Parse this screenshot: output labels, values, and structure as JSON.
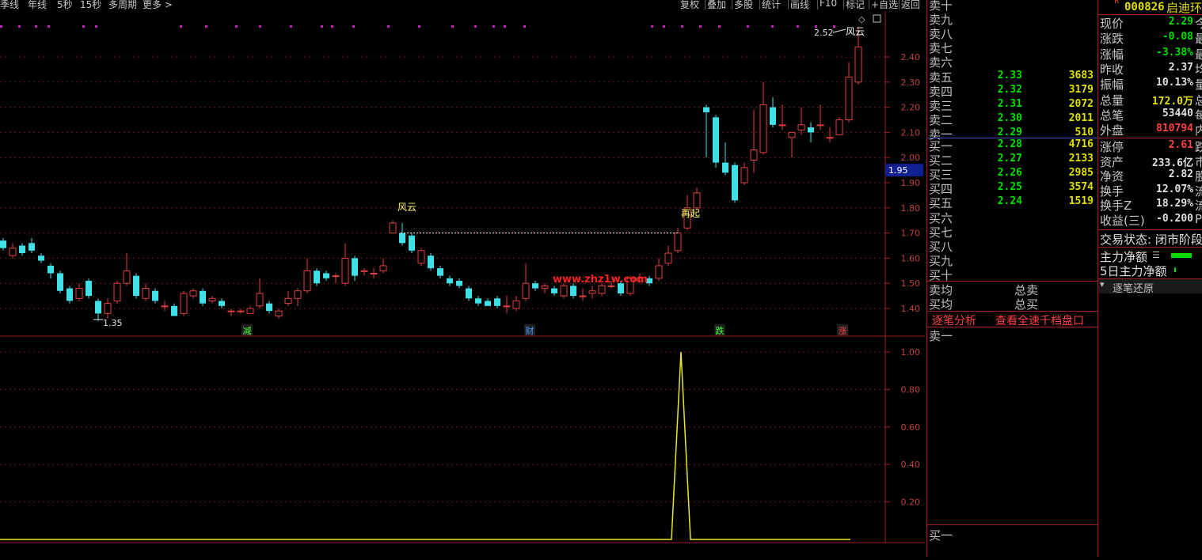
{
  "toolbar": {
    "left_items": [
      "季线",
      "年线",
      "5秒",
      "15秒",
      "多周期",
      "更多 >"
    ],
    "right_items": [
      "复权",
      "叠加",
      "多股",
      "统计",
      "画线",
      "F10",
      "标记",
      "+自选",
      "返回"
    ]
  },
  "chart": {
    "price_axis": [
      "2.40",
      "2.30",
      "2.20",
      "2.10",
      "2.00",
      "1.90",
      "1.80",
      "1.70",
      "1.60",
      "1.50",
      "1.40"
    ],
    "current_price_tag": "1.95",
    "high_label": "2.52",
    "low_label": "1.35",
    "annotations": [
      {
        "text": "风云",
        "color": "#ffff66"
      },
      {
        "text": "再起",
        "color": "#ffff66"
      },
      {
        "text": "风云",
        "color": "#ffffff"
      }
    ],
    "markers": [
      {
        "text": "减",
        "color": "#40ff40"
      },
      {
        "text": "财",
        "color": "#40a0ff"
      },
      {
        "text": "跌",
        "color": "#40ff40"
      },
      {
        "text": "涨",
        "color": "#ff4040"
      }
    ],
    "watermark": "www.zhz1w.com",
    "indicator_axis": [
      "1.00",
      "0.80",
      "0.60",
      "0.40",
      "0.20"
    ]
  },
  "chart_data": {
    "type": "line",
    "title": "",
    "indicator_series": {
      "name": "",
      "peak_value": 1.0,
      "baseline_value": 0.0
    },
    "ylim_price": [
      1.35,
      2.52
    ],
    "ylim_indicator": [
      0,
      1.0
    ]
  },
  "order_book": {
    "asks": [
      {
        "label": "卖十",
        "price": "",
        "vol": ""
      },
      {
        "label": "卖九",
        "price": "",
        "vol": ""
      },
      {
        "label": "卖八",
        "price": "",
        "vol": ""
      },
      {
        "label": "卖七",
        "price": "",
        "vol": ""
      },
      {
        "label": "卖六",
        "price": "",
        "vol": ""
      },
      {
        "label": "卖五",
        "price": "2.33",
        "vol": "3683"
      },
      {
        "label": "卖四",
        "price": "2.32",
        "vol": "3179"
      },
      {
        "label": "卖三",
        "price": "2.31",
        "vol": "2072"
      },
      {
        "label": "卖二",
        "price": "2.30",
        "vol": "2011"
      },
      {
        "label": "卖一",
        "price": "2.29",
        "vol": "510"
      }
    ],
    "bids": [
      {
        "label": "买一",
        "price": "2.28",
        "vol": "4716"
      },
      {
        "label": "买二",
        "price": "2.27",
        "vol": "2133"
      },
      {
        "label": "买三",
        "price": "2.26",
        "vol": "2985"
      },
      {
        "label": "买四",
        "price": "2.25",
        "vol": "3574"
      },
      {
        "label": "买五",
        "price": "2.24",
        "vol": "1519"
      },
      {
        "label": "买六",
        "price": "",
        "vol": ""
      },
      {
        "label": "买七",
        "price": "",
        "vol": ""
      },
      {
        "label": "买八",
        "price": "",
        "vol": ""
      },
      {
        "label": "买九",
        "price": "",
        "vol": ""
      },
      {
        "label": "买十",
        "price": "",
        "vol": ""
      }
    ],
    "avg_sell_label": "卖均",
    "avg_buy_label": "买均",
    "total_sell_label": "总卖",
    "total_buy_label": "总买",
    "tick_analysis": "逐笔分析",
    "view_full": "查看全速千档盘口",
    "sell1_label": "卖一",
    "buy1_label": "买一"
  },
  "quote": {
    "r_mark": "R",
    "code": "000826",
    "name": "启迪环",
    "rows": [
      {
        "k": "现价",
        "v": "2.29",
        "color": "#00e000",
        "cut": "今"
      },
      {
        "k": "涨跌",
        "v": "-0.08",
        "color": "#00e000",
        "cut": "最"
      },
      {
        "k": "涨幅",
        "v": "-3.38%",
        "color": "#00e000",
        "cut": "最"
      },
      {
        "k": "昨收",
        "v": "2.37",
        "color": "#e0e0e0",
        "cut": "均"
      },
      {
        "k": "振幅",
        "v": "10.13%",
        "color": "#e0e0e0",
        "cut": "量"
      },
      {
        "k": "总量",
        "v": "172.0万",
        "color": "#e0e000",
        "cut": "总"
      },
      {
        "k": "总笔",
        "v": "53440",
        "color": "#e0e0e0",
        "cut": "每"
      },
      {
        "k": "外盘",
        "v": "810794",
        "color": "#ff4040",
        "cut": "内"
      }
    ],
    "rows2": [
      {
        "k": "涨停",
        "v": "2.61",
        "color": "#ff4040",
        "cut": "跌"
      },
      {
        "k": "资产",
        "v": "233.6亿",
        "color": "#e0e0e0",
        "cut": "市"
      },
      {
        "k": "净资",
        "v": "2.82",
        "color": "#e0e0e0",
        "cut": "股"
      },
      {
        "k": "换手",
        "v": "12.07%",
        "color": "#e0e0e0",
        "cut": "流"
      },
      {
        "k": "换手Z",
        "v": "18.29%",
        "color": "#e0e0e0",
        "cut": "流"
      },
      {
        "k": "收益(三)",
        "v": "-0.200",
        "color": "#e0e0e0",
        "cut": "PE"
      }
    ],
    "trade_status": "交易状态: 闭市阶段",
    "main_net": "主力净额",
    "main_net_5d": "5日主力净额",
    "tick_restore": "逐笔还原"
  }
}
